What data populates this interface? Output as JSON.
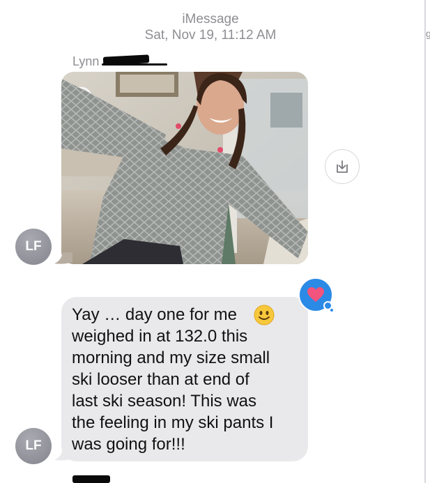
{
  "header": {
    "service": "iMessage",
    "timestamp": "Sat, Nov 19, 11:12 AM"
  },
  "sender": {
    "name": "Lynn",
    "initials": "LF"
  },
  "messages": [
    {
      "type": "photo",
      "alt": "selfie photo"
    },
    {
      "type": "text",
      "text": "Yay … day one for me\nweighed in at 132.0 this\nmorning and my size small\nski looser than at end of\nlast ski season!  This was\nthe feeling in my ski pants I\nwas going for!!!",
      "reaction": "heart"
    }
  ],
  "colors": {
    "bubble_received": "#e9e9eb",
    "tapback": "#2b8ae6",
    "heart": "#f2547d",
    "meta_text": "#8e8e93"
  },
  "edge_glyph": "g"
}
